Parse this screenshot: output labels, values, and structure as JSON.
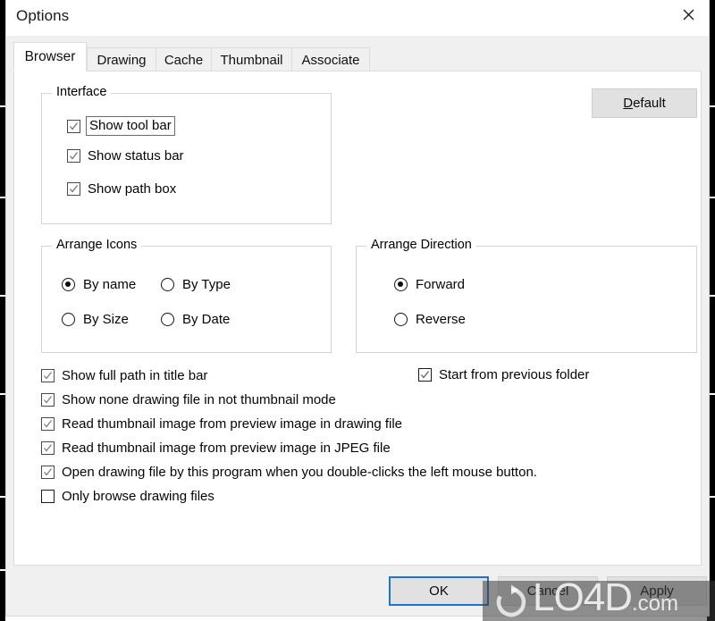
{
  "window": {
    "title": "Options",
    "close_icon": "close-icon"
  },
  "tabs": [
    {
      "label": "Browser",
      "active": true
    },
    {
      "label": "Drawing",
      "active": false
    },
    {
      "label": "Cache",
      "active": false
    },
    {
      "label": "Thumbnail",
      "active": false
    },
    {
      "label": "Associate",
      "active": false
    }
  ],
  "default_button": {
    "accel": "D",
    "rest": "efault",
    "label": "Default"
  },
  "interface_group": {
    "title": "Interface",
    "items": [
      {
        "label": "Show tool bar",
        "checked": true,
        "focused": true
      },
      {
        "label": "Show status bar",
        "checked": true,
        "focused": false
      },
      {
        "label": "Show path box",
        "checked": true,
        "focused": false
      }
    ]
  },
  "arrange_icons_group": {
    "title": "Arrange Icons",
    "options": [
      {
        "label": "By name",
        "selected": true
      },
      {
        "label": "By Type",
        "selected": false
      },
      {
        "label": "By Size",
        "selected": false
      },
      {
        "label": "By Date",
        "selected": false
      }
    ]
  },
  "arrange_direction_group": {
    "title": "Arrange Direction",
    "options": [
      {
        "label": "Forward",
        "selected": true
      },
      {
        "label": "Reverse",
        "selected": false
      }
    ]
  },
  "options_list": [
    {
      "label": "Show full path in title bar",
      "checked": true
    },
    {
      "label": "Show none drawing file in not thumbnail mode",
      "checked": true
    },
    {
      "label": "Read thumbnail image from preview image in drawing file",
      "checked": true
    },
    {
      "label": "Read thumbnail image from preview image in JPEG file",
      "checked": true
    },
    {
      "label": "Open drawing file by this program when you double-clicks the left mouse button.",
      "checked": true
    },
    {
      "label": "Only browse drawing files",
      "checked": false
    }
  ],
  "start_previous": {
    "label": "Start from previous folder",
    "checked": true
  },
  "footer_buttons": [
    {
      "label": "OK",
      "focused": true
    },
    {
      "label": "Cancel",
      "focused": false
    },
    {
      "label": "Apply",
      "focused": false
    }
  ],
  "watermark": {
    "brand": "LO4D",
    "suffix": ".com"
  },
  "colors": {
    "accent": "#1976d2",
    "dialog_bg": "#f0f0f0",
    "panel_bg": "#ffffff",
    "border": "#dcdcdc",
    "text": "#050505"
  }
}
